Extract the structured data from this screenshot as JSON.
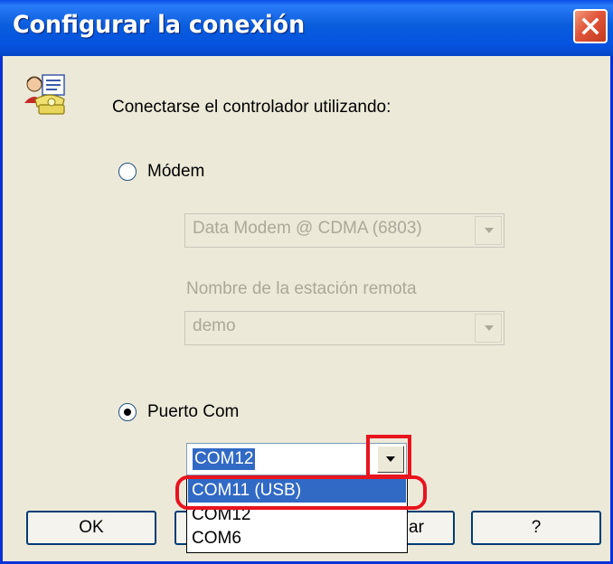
{
  "window": {
    "title": "Configurar la conexión",
    "close_icon": "close-x-icon",
    "app_icon": "connection-phone-user-icon"
  },
  "intro": "Conectarse el controlador utilizando:",
  "modem": {
    "label": "Módem",
    "selected": false,
    "enabled": false,
    "device_value": "Data Modem @ CDMA (6803)",
    "station_label": "Nombre de la estación remota",
    "station_value": "demo"
  },
  "com_port": {
    "label": "Puerto Com",
    "selected": true,
    "value": "COM12",
    "dropdown_open": true,
    "options": [
      "COM11 (USB)",
      "COM12",
      "COM6"
    ],
    "highlighted_option": "COM11 (USB)"
  },
  "buttons": {
    "ok": "OK",
    "cancel_partial": "ar",
    "help": "?"
  },
  "colors": {
    "titlebar": "#0a5ddc",
    "selection": "#316ac5",
    "annotation": "#e8141e",
    "dialog_bg": "#ece9d8"
  }
}
